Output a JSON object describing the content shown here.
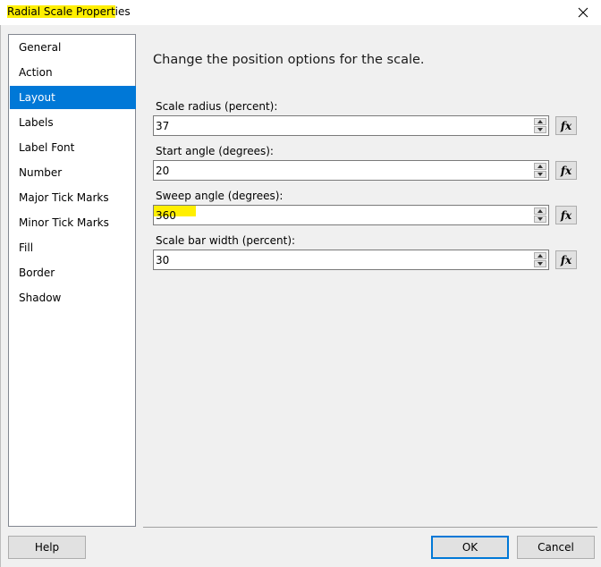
{
  "window": {
    "title_highlighted": "Radial Scale Propert",
    "title_rest": "ies"
  },
  "nav": {
    "items": [
      {
        "label": "General",
        "selected": false
      },
      {
        "label": "Action",
        "selected": false
      },
      {
        "label": "Layout",
        "selected": true
      },
      {
        "label": "Labels",
        "selected": false
      },
      {
        "label": "Label Font",
        "selected": false
      },
      {
        "label": "Number",
        "selected": false
      },
      {
        "label": "Major Tick Marks",
        "selected": false
      },
      {
        "label": "Minor Tick Marks",
        "selected": false
      },
      {
        "label": "Fill",
        "selected": false
      },
      {
        "label": "Border",
        "selected": false
      },
      {
        "label": "Shadow",
        "selected": false
      }
    ]
  },
  "main": {
    "heading": "Change the position options for the scale.",
    "fields": [
      {
        "label": "Scale radius (percent):",
        "value": "37"
      },
      {
        "label": "Start angle (degrees):",
        "value": "20"
      },
      {
        "label": "Sweep angle (degrees):",
        "value": "360"
      },
      {
        "label": "Scale bar width (percent):",
        "value": "30"
      }
    ],
    "fx_label": "fx"
  },
  "footer": {
    "help": "Help",
    "ok": "OK",
    "cancel": "Cancel"
  },
  "colors": {
    "selection": "#0078d7",
    "highlight": "#ffef00",
    "dialog_bg": "#f0f0f0"
  },
  "icons": {
    "close": "close-icon",
    "spin_up": "chevron-up-icon",
    "spin_down": "chevron-down-icon",
    "function": "function-icon"
  }
}
